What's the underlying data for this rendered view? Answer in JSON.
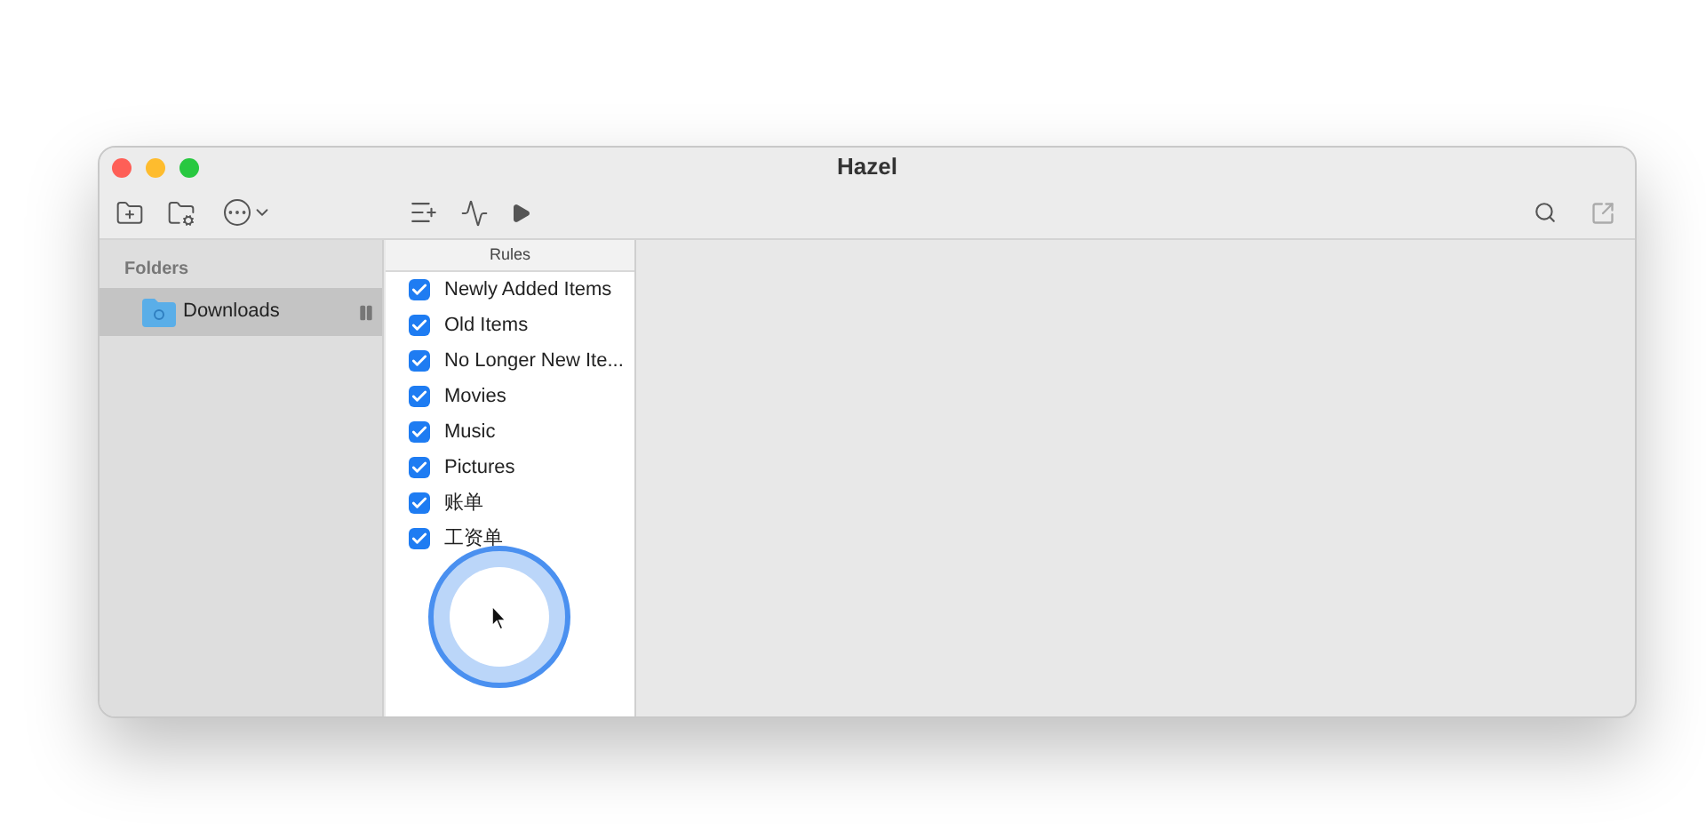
{
  "window": {
    "title": "Hazel"
  },
  "sidebar": {
    "heading": "Folders",
    "items": [
      {
        "label": "Downloads",
        "selected": true,
        "paused": true
      }
    ]
  },
  "rules": {
    "heading": "Rules",
    "items": [
      {
        "label": "Newly Added Items",
        "checked": true
      },
      {
        "label": "Old Items",
        "checked": true
      },
      {
        "label": "No Longer New Ite...",
        "checked": true
      },
      {
        "label": "Movies",
        "checked": true
      },
      {
        "label": "Music",
        "checked": true
      },
      {
        "label": "Pictures",
        "checked": true
      },
      {
        "label": "账单",
        "checked": true
      },
      {
        "label": "工资单",
        "checked": true
      }
    ]
  }
}
